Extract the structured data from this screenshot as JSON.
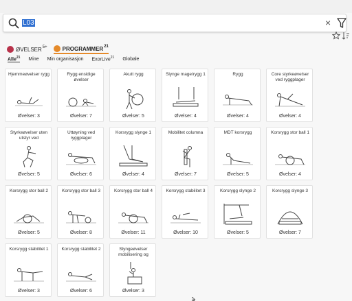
{
  "search": {
    "value": "L03"
  },
  "types": [
    {
      "label": "ØVELSER",
      "count": "5+",
      "color": "#b8324a",
      "active": false
    },
    {
      "label": "PROGRAMMER",
      "count": "21",
      "color": "#e58a2a",
      "active": true
    }
  ],
  "subtabs": [
    {
      "label": "Alle",
      "count": "21",
      "active": true
    },
    {
      "label": "Mine",
      "count": "",
      "active": false
    },
    {
      "label": "Min organisasjon",
      "count": "",
      "active": false
    },
    {
      "label": "ExorLive",
      "count": "21",
      "active": false
    },
    {
      "label": "Globale",
      "count": "",
      "active": false
    }
  ],
  "programs": [
    {
      "title": "Hjemmeøvelser rygg",
      "count": "Øvelser: 3",
      "icon": "floor-stretch"
    },
    {
      "title": "Rygg ensidige øvelser",
      "count": "Øvelser: 7",
      "icon": "ball-floor"
    },
    {
      "title": "Akutt rygg",
      "count": "Øvelser: 5",
      "icon": "ball-standing"
    },
    {
      "title": "Slynge mage/rygg 1",
      "count": "Øvelser: 4",
      "icon": "sling-bench"
    },
    {
      "title": "Rygg",
      "count": "Øvelser: 4",
      "icon": "plank"
    },
    {
      "title": "Core styrkeøvelser ved ryggplager",
      "count": "Øvelser: 4",
      "icon": "side-plank"
    },
    {
      "title": "Styrkeøvelser uten utstyr ved",
      "count": "Øvelser: 5",
      "icon": "squat"
    },
    {
      "title": "Uttøyning ved ryggplager",
      "count": "Øvelser: 6",
      "icon": "roller"
    },
    {
      "title": "Korsrygg slynge 1",
      "count": "Øvelser: 4",
      "icon": "sling-legs"
    },
    {
      "title": "Mobilitet columna",
      "count": "Øvelser: 7",
      "icon": "chair"
    },
    {
      "title": "MDT korsrygg",
      "count": "Øvelser: 5",
      "icon": "prone-press"
    },
    {
      "title": "Korsrygg stor ball 1",
      "count": "Øvelser: 4",
      "icon": "ball-prone"
    },
    {
      "title": "Korsrygg stor ball 2",
      "count": "Øvelser: 5",
      "icon": "ball-lying"
    },
    {
      "title": "Korsrygg stor ball 3",
      "count": "Øvelser: 8",
      "icon": "ball-bridge"
    },
    {
      "title": "Korsrygg stor ball 4",
      "count": "Øvelser: 11",
      "icon": "ball-prone"
    },
    {
      "title": "Korsrygg stabilitet 3",
      "count": "Øvelser: 10",
      "icon": "prone-lying"
    },
    {
      "title": "Korsrygg slynge 2",
      "count": "Øvelser: 5",
      "icon": "sling-frame"
    },
    {
      "title": "Korsrygg slynge 3",
      "count": "Øvelser: 7",
      "icon": "sling-arch"
    },
    {
      "title": "Korsrygg stabilitet 1",
      "count": "Øvelser: 3",
      "icon": "quadruped"
    },
    {
      "title": "Korsrygg stabilitet 2",
      "count": "Øvelser: 6",
      "icon": "side-lying"
    },
    {
      "title": "Slyngeøvelser mobilisering og",
      "count": "Øvelser: 3",
      "icon": "sling-seated"
    }
  ]
}
